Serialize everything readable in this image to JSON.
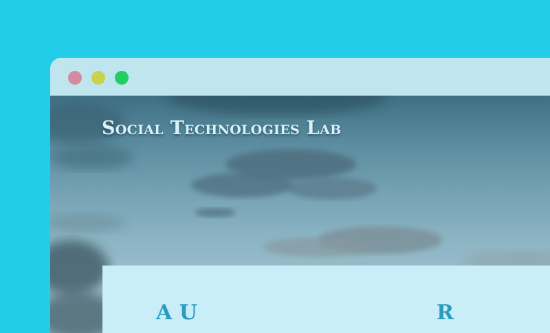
{
  "window": {
    "controls": {
      "close_color": "#d48aa1",
      "minimize_color": "#c9d24c",
      "maximize_color": "#22cd62"
    }
  },
  "header": {
    "site_title": "Social Technologies Lab"
  },
  "content": {
    "left_heading": "A    U",
    "right_heading": "R"
  },
  "colors": {
    "page_background": "#23cce8",
    "titlebar": "#bfe6ee",
    "card_background": "#c9eef7",
    "heading_accent": "#2a9cc0"
  },
  "icons": {
    "close": "close-dot-icon",
    "minimize": "minimize-dot-icon",
    "maximize": "maximize-dot-icon"
  }
}
